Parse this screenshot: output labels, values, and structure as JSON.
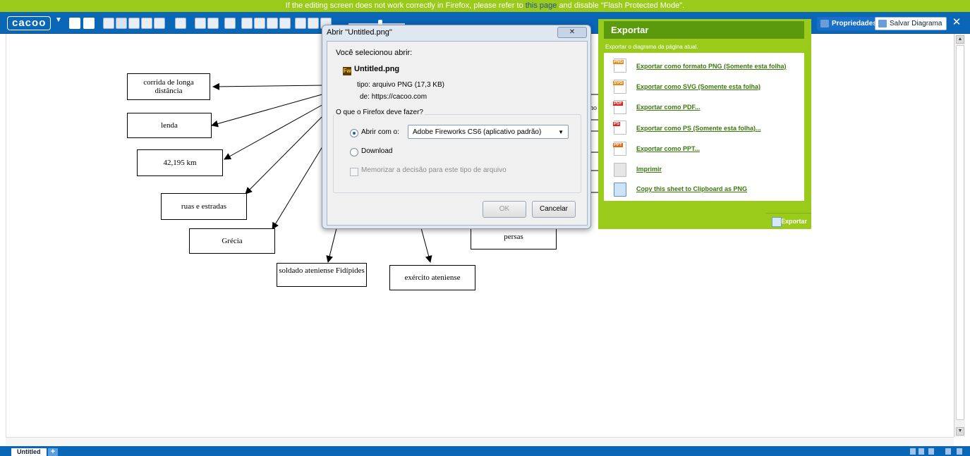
{
  "notice": {
    "before": "If the editing screen does not work correctly in Firefox, please refer to ",
    "link": "this page",
    "after": " and disable \"Flash Protected Mode\"."
  },
  "toolbar": {
    "logo": "cacoo",
    "properties_label": "Propriedades",
    "save_label": "Salvar Diagrama",
    "close_glyph": "✕"
  },
  "diagram": {
    "nodes": [
      "corrida de longa distância",
      "lenda",
      "42,195 km",
      "ruas e estradas",
      "Grécia",
      "soldado ateniense Fidípides",
      "exército ateniense",
      "persas",
      "no"
    ]
  },
  "dialog": {
    "title": "Abrir \"Untitled.png\"",
    "intro": "Você selecionou abrir:",
    "filename": "Untitled.png",
    "file_icon": "Fw",
    "type_label": "tipo:",
    "type_value": "arquivo PNG (17,3 KB)",
    "from_label": "de:",
    "from_value": "https://cacoo.com",
    "question": "O que o Firefox deve fazer?",
    "open_with_label": "Abrir com o:",
    "open_with_app": "Adobe Fireworks CS6 (aplicativo padrão)",
    "download_label": "Download",
    "remember_label": "Memorizar a decisão para este tipo de arquivo",
    "ok_label": "OK",
    "cancel_label": "Cancelar"
  },
  "export": {
    "title": "Exportar",
    "subtitle": "Exportar o diagrama da página atual.",
    "items": [
      {
        "label": "Exportar como formato PNG (Somente esta folha)",
        "badge": "PNG"
      },
      {
        "label": "Exportar como SVG (Somente esta folha)",
        "badge": "SVG"
      },
      {
        "label": "Exportar como PDF...",
        "badge": "PDF"
      },
      {
        "label": "Exportar como PS (Somente esta folha)...",
        "badge": "PS"
      },
      {
        "label": "Exportar como PPT...",
        "badge": "PPT"
      },
      {
        "label": "Imprimir",
        "badge": ""
      },
      {
        "label": "Copy this sheet to Clipboard as PNG",
        "badge": ""
      }
    ],
    "footer_label": "Exportar"
  },
  "sheets": {
    "current": "Untitled",
    "add_glyph": "+"
  },
  "colors": {
    "brand_blue": "#0a66b7",
    "notice_green": "#9bcb1a",
    "export_header": "#5c9a0d",
    "link_green": "#3a7a0d"
  }
}
